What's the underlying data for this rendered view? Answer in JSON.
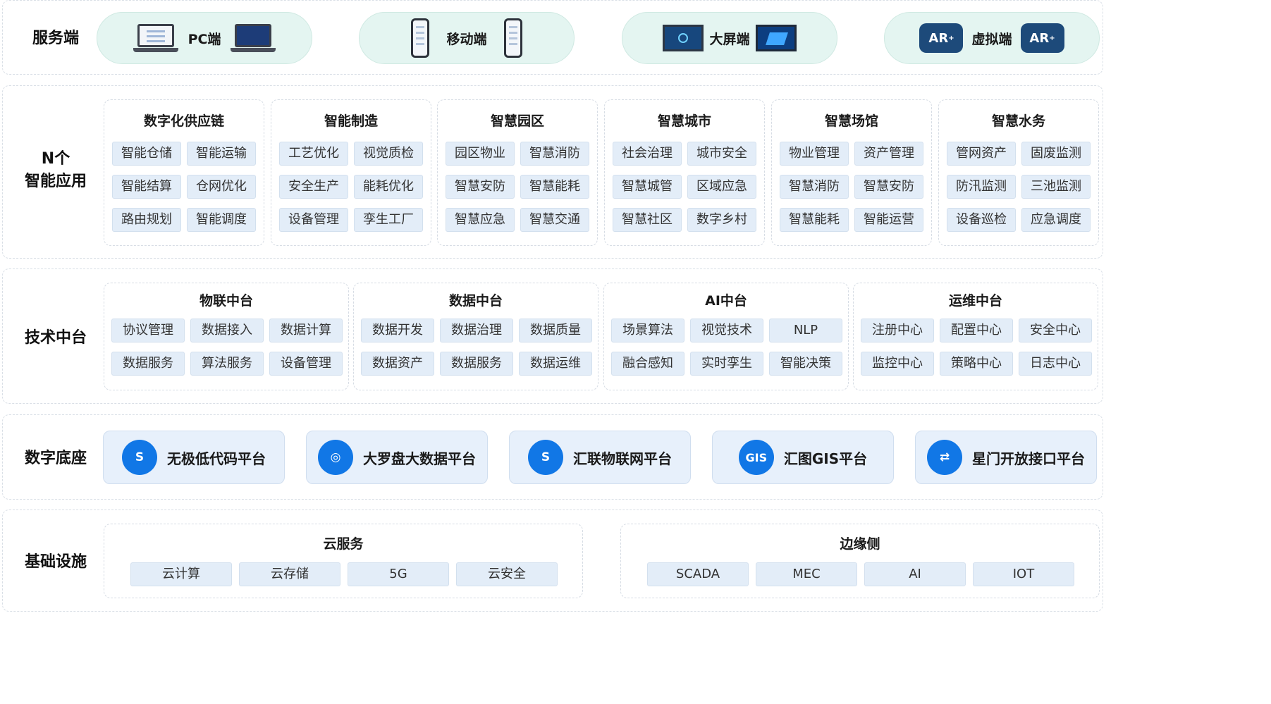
{
  "rows": {
    "clients": "服务端",
    "apps": "N个\n智能应用",
    "tech": "技术中台",
    "base": "数字底座",
    "infra": "基础设施"
  },
  "clients": [
    {
      "label": "PC端",
      "icon_left": "laptop-icon",
      "icon_right": "laptop-dark-icon"
    },
    {
      "label": "移动端",
      "icon_left": "phone-icon",
      "icon_right": "phone-icon"
    },
    {
      "label": "大屏端",
      "icon_left": "big-screen-icon",
      "icon_right": "big-screen-3d-icon"
    },
    {
      "label": "虚拟端",
      "icon_left": "ar-icon",
      "icon_right": "ar-icon",
      "ar_text": "AR",
      "ar_sup": "+"
    }
  ],
  "apps": [
    {
      "title": "数字化供应链",
      "items": [
        "智能仓储",
        "智能运输",
        "智能结算",
        "仓网优化",
        "路由规划",
        "智能调度"
      ]
    },
    {
      "title": "智能制造",
      "items": [
        "工艺优化",
        "视觉质检",
        "安全生产",
        "能耗优化",
        "设备管理",
        "孪生工厂"
      ]
    },
    {
      "title": "智慧园区",
      "items": [
        "园区物业",
        "智慧消防",
        "智慧安防",
        "智慧能耗",
        "智慧应急",
        "智慧交通"
      ]
    },
    {
      "title": "智慧城市",
      "items": [
        "社会治理",
        "城市安全",
        "智慧城管",
        "区域应急",
        "智慧社区",
        "数字乡村"
      ]
    },
    {
      "title": "智慧场馆",
      "items": [
        "物业管理",
        "资产管理",
        "智慧消防",
        "智慧安防",
        "智慧能耗",
        "智能运营"
      ]
    },
    {
      "title": "智慧水务",
      "items": [
        "管网资产",
        "固废监测",
        "防汛监测",
        "三池监测",
        "设备巡检",
        "应急调度"
      ]
    }
  ],
  "tech": [
    {
      "title": "物联中台",
      "items": [
        "协议管理",
        "数据接入",
        "数据计算",
        "数据服务",
        "算法服务",
        "设备管理"
      ]
    },
    {
      "title": "数据中台",
      "items": [
        "数据开发",
        "数据治理",
        "数据质量",
        "数据资产",
        "数据服务",
        "数据运维"
      ]
    },
    {
      "title": "AI中台",
      "items": [
        "场景算法",
        "视觉技术",
        "NLP",
        "融合感知",
        "实时孪生",
        "智能决策"
      ]
    },
    {
      "title": "运维中台",
      "items": [
        "注册中心",
        "配置中心",
        "安全中心",
        "监控中心",
        "策略中心",
        "日志中心"
      ]
    }
  ],
  "platforms": [
    {
      "label": "无极低代码平台",
      "icon": "lowcode-icon",
      "glyph": "S"
    },
    {
      "label": "大罗盘大数据平台",
      "icon": "compass-icon",
      "glyph": "◎"
    },
    {
      "label": "汇联物联网平台",
      "icon": "iot-link-icon",
      "glyph": "S"
    },
    {
      "label": "汇图GIS平台",
      "icon": "gis-icon",
      "glyph": "GIS"
    },
    {
      "label": "星门开放接口平台",
      "icon": "api-gate-icon",
      "glyph": "⇄"
    }
  ],
  "infra": [
    {
      "title": "云服务",
      "items": [
        "云计算",
        "云存储",
        "5G",
        "云安全"
      ]
    },
    {
      "title": "边缘侧",
      "items": [
        "SCADA",
        "MEC",
        "AI",
        "IOT"
      ]
    }
  ],
  "colors": {
    "accent": "#1177e6",
    "chip": "#e3edf8",
    "pill": "#e4f5f1"
  }
}
